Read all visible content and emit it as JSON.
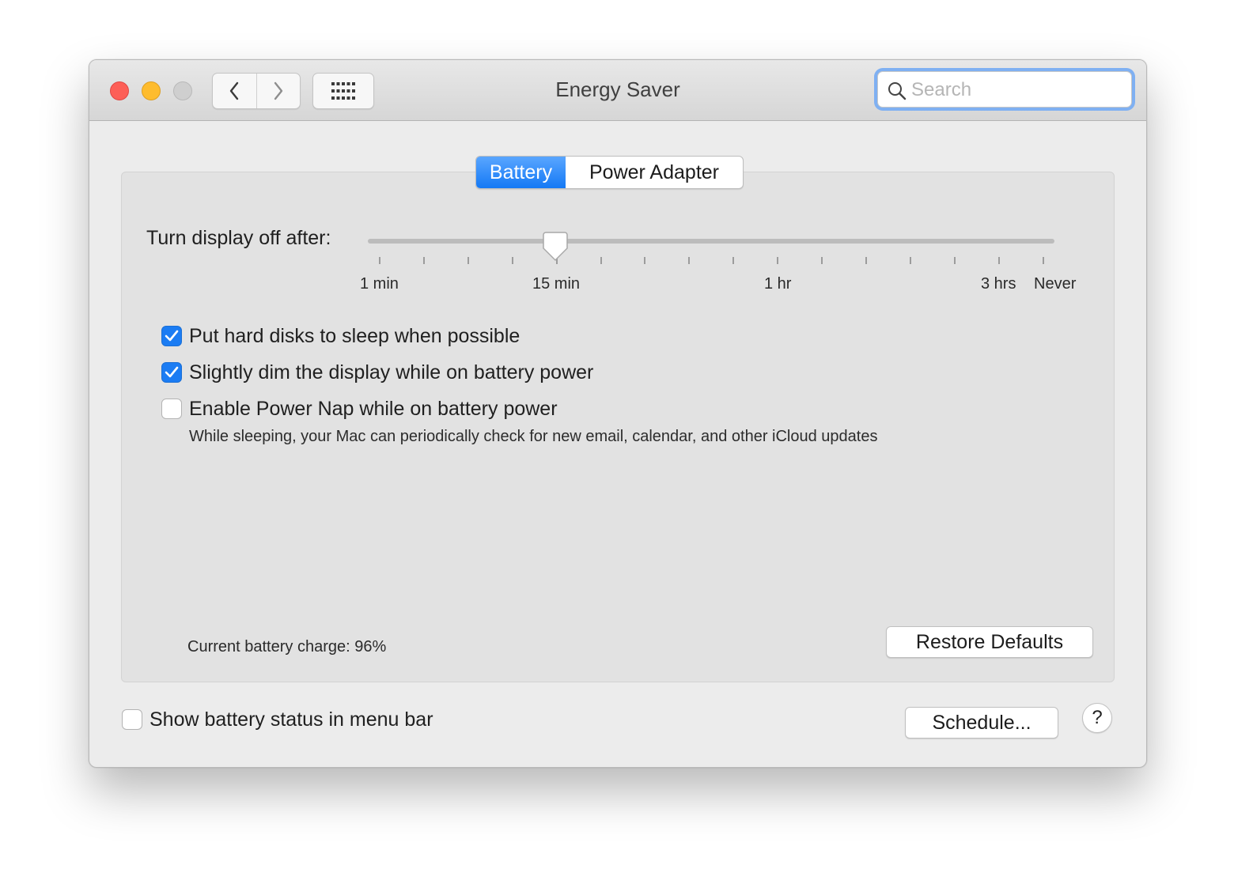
{
  "window": {
    "title": "Energy Saver"
  },
  "toolbar": {
    "back_icon": "chevron-left-icon",
    "forward_icon": "chevron-right-icon",
    "show_all_icon": "grid-icon"
  },
  "search": {
    "placeholder": "Search",
    "value": ""
  },
  "tabs": [
    {
      "label": "Battery",
      "selected": true
    },
    {
      "label": "Power Adapter",
      "selected": false
    }
  ],
  "display_sleep": {
    "label": "Turn display off after:",
    "value": "15 min",
    "tick_labels": [
      "1 min",
      "15 min",
      "1 hr",
      "3 hrs",
      "Never"
    ]
  },
  "options": [
    {
      "label": "Put hard disks to sleep when possible",
      "checked": true
    },
    {
      "label": "Slightly dim the display while on battery power",
      "checked": true
    },
    {
      "label": "Enable Power Nap while on battery power",
      "checked": false,
      "note": "While sleeping, your Mac can periodically check for new email, calendar, and other iCloud updates"
    }
  ],
  "battery": {
    "charge_text": "Current battery charge: 96%"
  },
  "buttons": {
    "restore_defaults": "Restore Defaults",
    "schedule": "Schedule...",
    "help": "?"
  },
  "footer": {
    "show_status_label": "Show battery status in menu bar",
    "show_status_checked": false
  },
  "colors": {
    "accent": "#1b7cf3",
    "close": "#fd5f57",
    "minimize": "#febc2e",
    "zoom_disabled": "#cfcfcf"
  }
}
